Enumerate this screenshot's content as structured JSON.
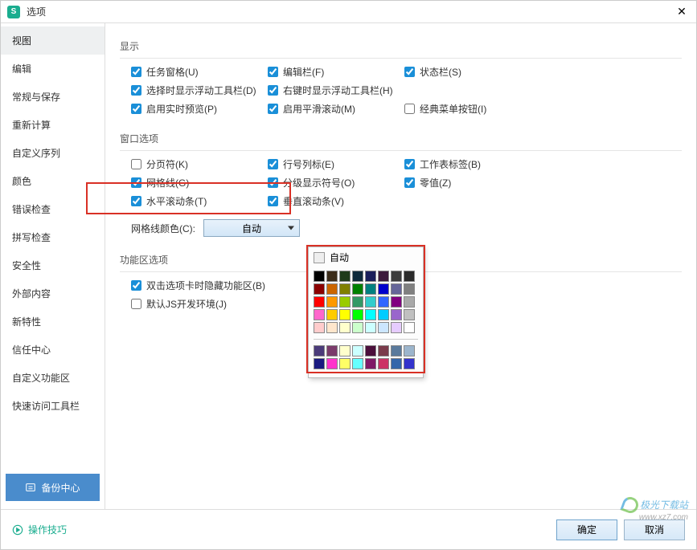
{
  "titlebar": {
    "title": "选项",
    "app_letter": "S"
  },
  "sidebar": {
    "items": [
      {
        "label": "视图",
        "active": true
      },
      {
        "label": "编辑"
      },
      {
        "label": "常规与保存"
      },
      {
        "label": "重新计算"
      },
      {
        "label": "自定义序列"
      },
      {
        "label": "颜色"
      },
      {
        "label": "错误检查"
      },
      {
        "label": "拼写检查"
      },
      {
        "label": "安全性"
      },
      {
        "label": "外部内容"
      },
      {
        "label": "新特性"
      },
      {
        "label": "信任中心"
      },
      {
        "label": "自定义功能区"
      },
      {
        "label": "快速访问工具栏"
      }
    ],
    "backup": "备份中心"
  },
  "sections": {
    "display": {
      "title": "显示",
      "opts": [
        {
          "label": "任务窗格(U)",
          "checked": true
        },
        {
          "label": "编辑栏(F)",
          "checked": true
        },
        {
          "label": "状态栏(S)",
          "checked": true
        },
        {
          "label": "选择时显示浮动工具栏(D)",
          "checked": true
        },
        {
          "label": "右键时显示浮动工具栏(H)",
          "checked": true
        },
        {
          "label": ""
        },
        {
          "label": "启用实时预览(P)",
          "checked": true
        },
        {
          "label": "启用平滑滚动(M)",
          "checked": true
        },
        {
          "label": "经典菜单按钮(I)",
          "checked": false
        }
      ]
    },
    "window": {
      "title": "窗口选项",
      "opts": [
        {
          "label": "分页符(K)",
          "checked": false
        },
        {
          "label": "行号列标(E)",
          "checked": true
        },
        {
          "label": "工作表标签(B)",
          "checked": true
        },
        {
          "label": "网格线(G)",
          "checked": true
        },
        {
          "label": "分级显示符号(O)",
          "checked": true
        },
        {
          "label": "零值(Z)",
          "checked": true
        },
        {
          "label": "水平滚动条(T)",
          "checked": true
        },
        {
          "label": "垂直滚动条(V)",
          "checked": true
        },
        {
          "label": ""
        }
      ],
      "gridcolor_label": "网格线颜色(C):",
      "gridcolor_value": "自动"
    },
    "ribbon": {
      "title": "功能区选项",
      "opts": [
        {
          "label": "双击选项卡时隐藏功能区(B)",
          "checked": true
        },
        {
          "label": "默认JS开发环境(J)",
          "checked": false
        }
      ]
    }
  },
  "color_popup": {
    "auto": "自动",
    "palette1": [
      "#000000",
      "#3b2c1a",
      "#1f3b1a",
      "#0f2a3b",
      "#1a1f5a",
      "#3b1a3b",
      "#3b3b3b",
      "#2b2b2b",
      "#8b0000",
      "#cc6600",
      "#808000",
      "#008000",
      "#008080",
      "#0000cc",
      "#666699",
      "#808080",
      "#ff0000",
      "#ff9900",
      "#99cc00",
      "#339966",
      "#33cccc",
      "#3366ff",
      "#800080",
      "#a9a9a9",
      "#ff66cc",
      "#ffcc00",
      "#ffff00",
      "#00ff00",
      "#00ffff",
      "#00ccff",
      "#9966cc",
      "#c0c0c0",
      "#ffcccc",
      "#ffe6cc",
      "#ffffcc",
      "#ccffcc",
      "#ccffff",
      "#cce6ff",
      "#e6ccff",
      "#ffffff"
    ],
    "palette2": [
      "#4b3b7a",
      "#7a3b6b",
      "#ffffcc",
      "#ccffff",
      "#4b0f3b",
      "#7a3b4b",
      "#5a7a9c",
      "#9cb5cc",
      "#1a1a80",
      "#ff33cc",
      "#ffff66",
      "#66ffff",
      "#801a66",
      "#cc3366",
      "#3366aa",
      "#3333cc"
    ]
  },
  "footer": {
    "tips": "操作技巧",
    "ok": "确定",
    "cancel": "取消"
  },
  "watermark": {
    "name": "极光下载站",
    "url": "www.xz7.com"
  }
}
